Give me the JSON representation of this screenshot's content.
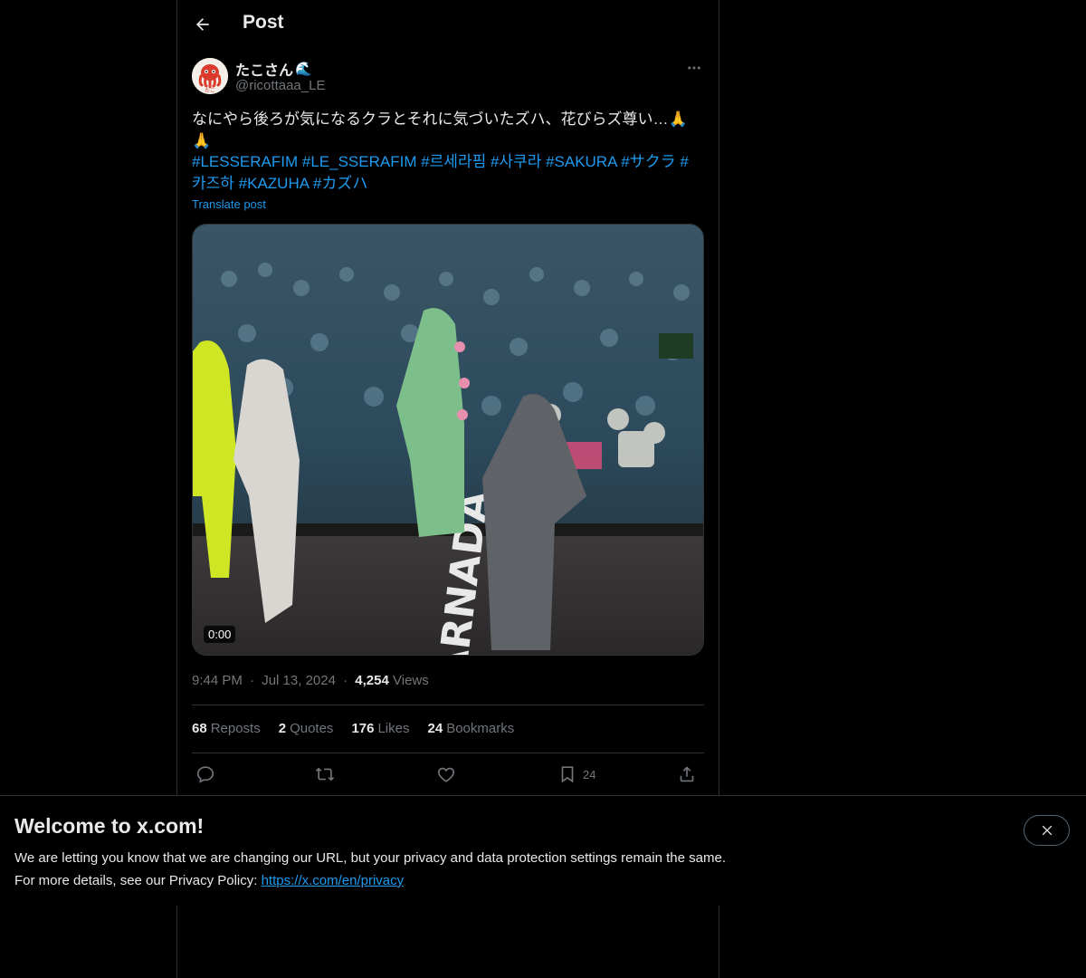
{
  "header": {
    "title": "Post",
    "back_icon": "arrow-left-icon"
  },
  "author": {
    "display_name": "たこさん",
    "name_emoji": "🌊",
    "handle": "@ricottaaa_LE",
    "avatar_label": "たこ"
  },
  "post": {
    "text": "なにやら後ろが気になるクラとそれに気づいたズハ、花びらズ尊い…🙏🙏",
    "hashtags": [
      "#LESSERAFIM",
      "#LE_SSERAFIM",
      "#르세라핌",
      "#사쿠라",
      "#SAKURA",
      "#サクラ",
      "#카즈하",
      "#KAZUHA",
      "#カズハ"
    ],
    "translate_label": "Translate post",
    "video_duration": "0:00",
    "stage_text": "FEARNADA"
  },
  "meta": {
    "time": "9:44 PM",
    "separator": "·",
    "date": "Jul 13, 2024",
    "views_count": "4,254",
    "views_label": "Views"
  },
  "stats": {
    "reposts_count": "68",
    "reposts_label": "Reposts",
    "quotes_count": "2",
    "quotes_label": "Quotes",
    "likes_count": "176",
    "likes_label": "Likes",
    "bookmarks_count": "24",
    "bookmarks_label": "Bookmarks"
  },
  "actions": {
    "bookmark_count": "24"
  },
  "banner": {
    "title": "Welcome to x.com!",
    "line1": "We are letting you know that we are changing our URL, but your privacy and data protection settings remain the same.",
    "line2_prefix": "For more details, see our Privacy Policy: ",
    "link": "https://x.com/en/privacy"
  },
  "colors": {
    "background": "#000000",
    "text": "#e7e9ea",
    "muted": "#71767b",
    "accent": "#1d9bf0",
    "border": "#2f3336"
  }
}
